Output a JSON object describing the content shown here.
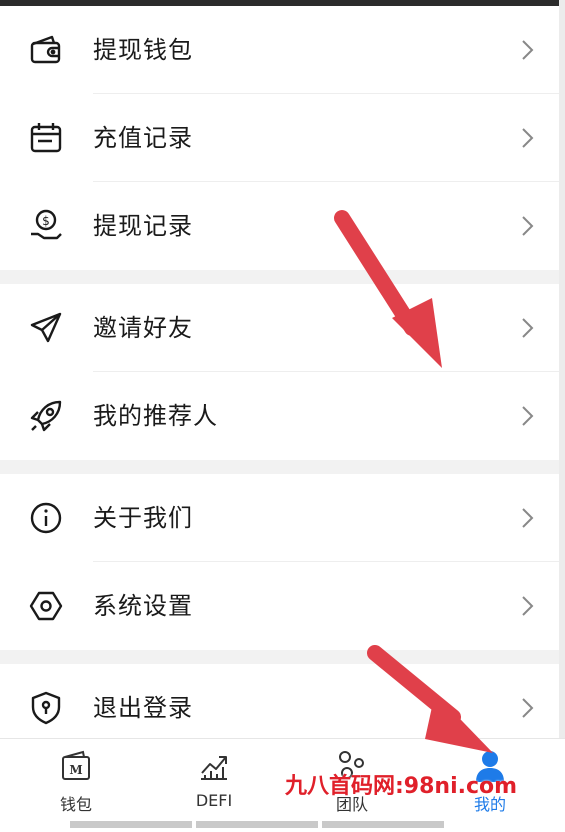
{
  "menu": {
    "group1": [
      {
        "label": "提现钱包",
        "icon": "wallet-icon"
      },
      {
        "label": "充值记录",
        "icon": "calendar-icon"
      },
      {
        "label": "提现记录",
        "icon": "money-hand-icon"
      }
    ],
    "group2": [
      {
        "label": "邀请好友",
        "icon": "paper-plane-icon"
      },
      {
        "label": "我的推荐人",
        "icon": "rocket-icon"
      }
    ],
    "group3": [
      {
        "label": "关于我们",
        "icon": "info-icon"
      },
      {
        "label": "系统设置",
        "icon": "settings-hexagon-icon"
      }
    ],
    "group4": [
      {
        "label": "退出登录",
        "icon": "shield-lock-icon"
      }
    ]
  },
  "tabbar": {
    "tabs": [
      {
        "label": "钱包",
        "icon": "wallet-m-icon",
        "active": false
      },
      {
        "label": "DEFI",
        "icon": "chart-up-icon",
        "active": false
      },
      {
        "label": "团队",
        "icon": "team-icon",
        "active": false
      },
      {
        "label": "我的",
        "icon": "user-icon",
        "active": true
      }
    ]
  },
  "watermark": {
    "text": "九八首码网:98ni.com"
  },
  "colors": {
    "accent": "#1e7be8",
    "annotation_arrow": "#e0404a",
    "watermark": "#e0202a"
  }
}
